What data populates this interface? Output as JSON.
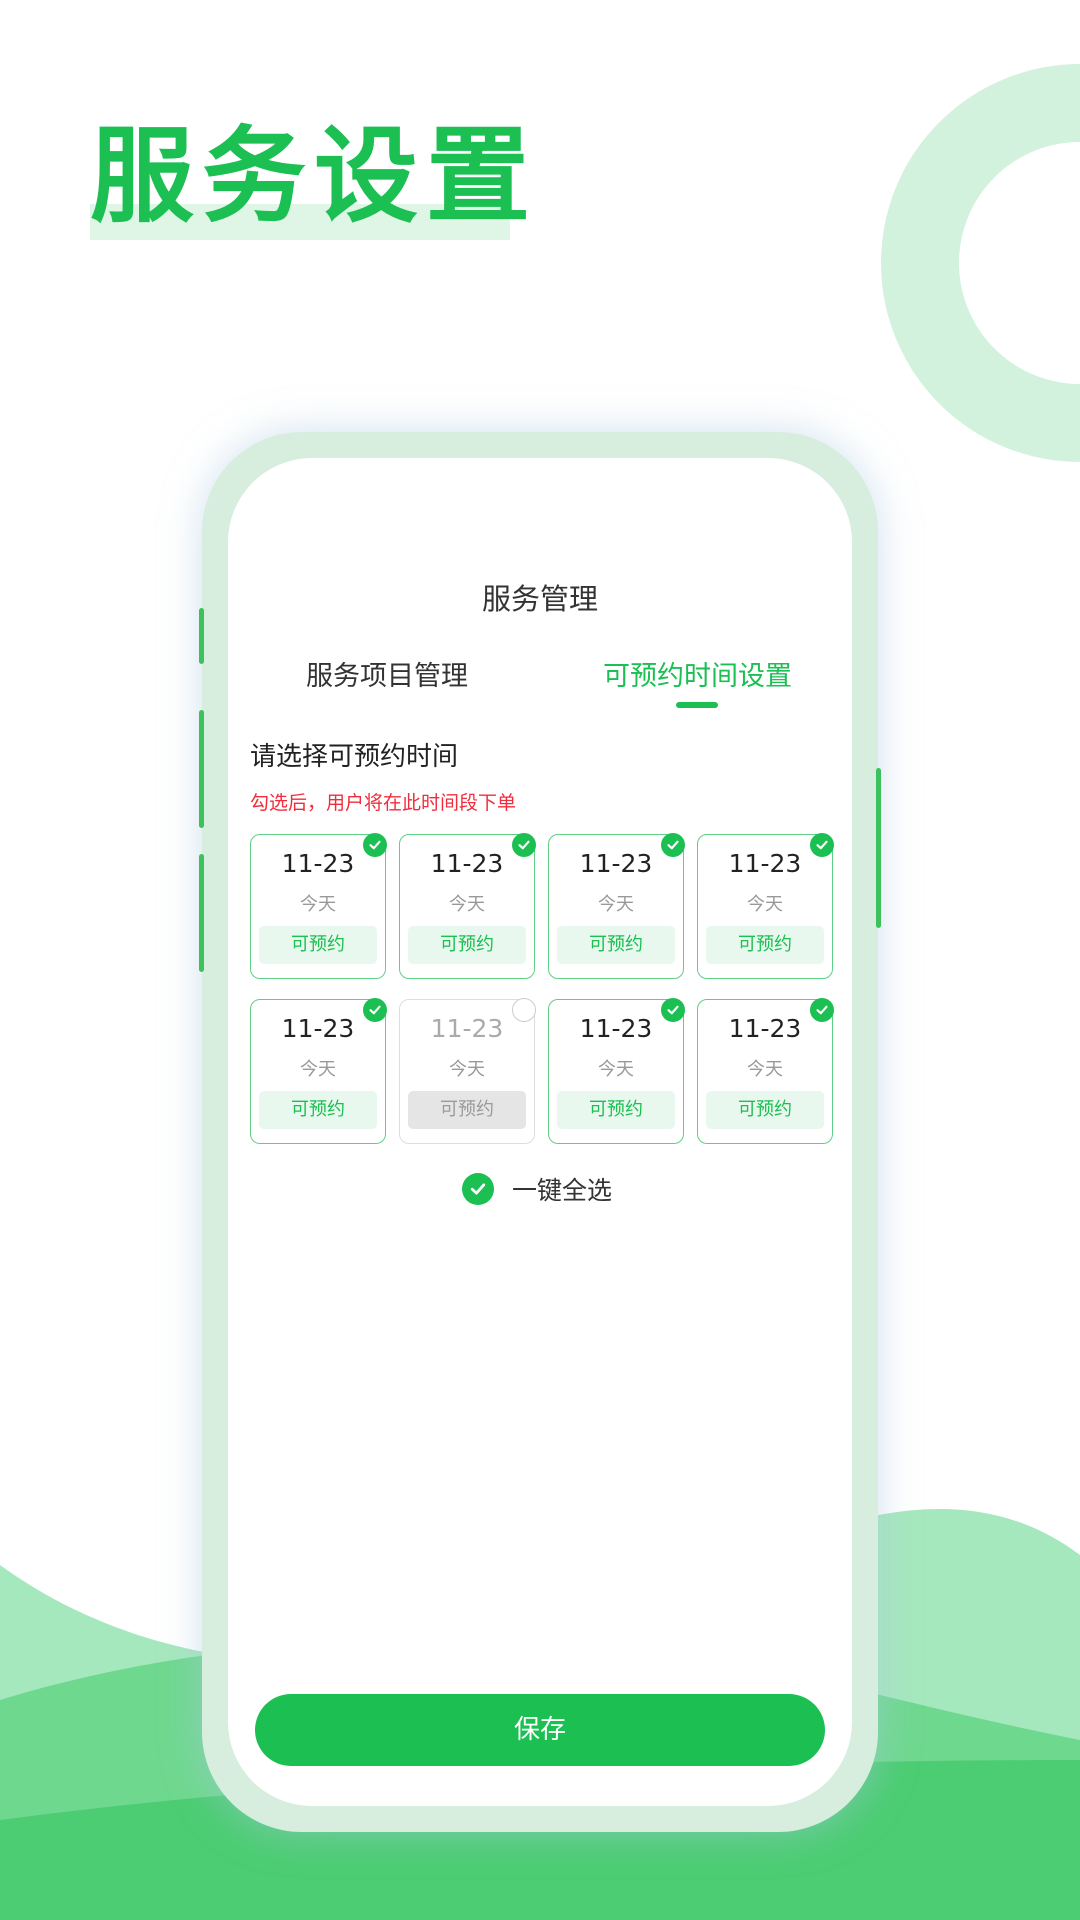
{
  "hero": {
    "title": "服务设置"
  },
  "colors": {
    "accent": "#1bbf52",
    "accent_light": "#e9f8ee",
    "hint": "#f02d3c",
    "phone_frame": "#d7eede"
  },
  "header": {
    "title": "服务管理"
  },
  "tabs": [
    {
      "label": "服务项目管理",
      "active": false
    },
    {
      "label": "可预约时间设置",
      "active": true
    }
  ],
  "section": {
    "title": "请选择可预约时间",
    "hint": "勾选后，用户将在此时间段下单"
  },
  "slots": [
    {
      "date": "11-23",
      "day": "今天",
      "status": "可预约",
      "checked": true
    },
    {
      "date": "11-23",
      "day": "今天",
      "status": "可预约",
      "checked": true
    },
    {
      "date": "11-23",
      "day": "今天",
      "status": "可预约",
      "checked": true
    },
    {
      "date": "11-23",
      "day": "今天",
      "status": "可预约",
      "checked": true
    },
    {
      "date": "11-23",
      "day": "今天",
      "status": "可预约",
      "checked": true
    },
    {
      "date": "11-23",
      "day": "今天",
      "status": "可预约",
      "checked": false
    },
    {
      "date": "11-23",
      "day": "今天",
      "status": "可预约",
      "checked": true
    },
    {
      "date": "11-23",
      "day": "今天",
      "status": "可预约",
      "checked": true
    }
  ],
  "select_all": {
    "label": "一键全选",
    "checked": true
  },
  "save_button": {
    "label": "保存"
  },
  "icons": {
    "slot_check": "check-circle-icon",
    "select_all": "check-circle-icon"
  }
}
